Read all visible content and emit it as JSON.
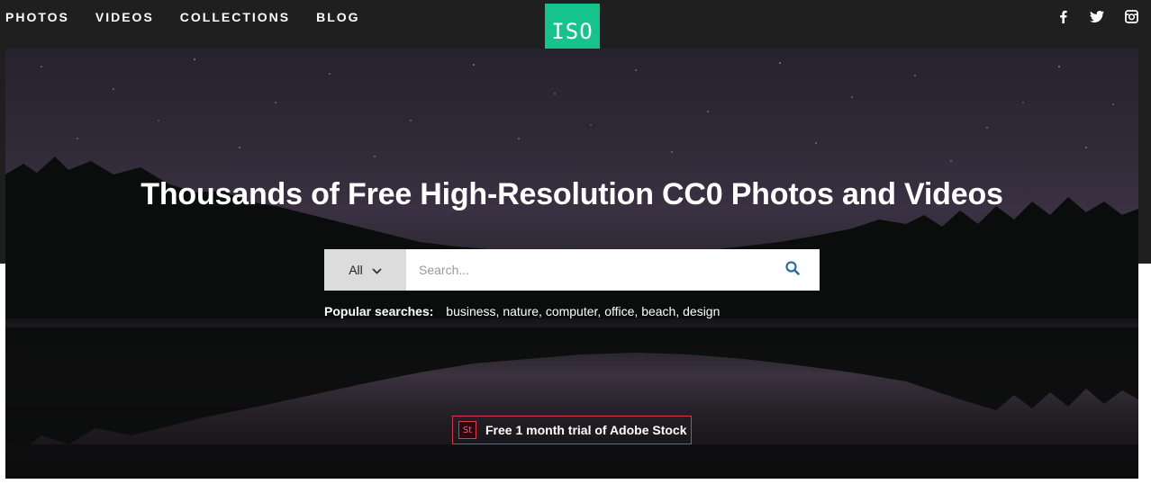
{
  "nav": {
    "items": [
      "PHOTOS",
      "VIDEOS",
      "COLLECTIONS",
      "BLOG"
    ]
  },
  "logo": {
    "text": "ISO"
  },
  "social": {
    "icons": [
      "facebook-icon",
      "twitter-icon",
      "instagram-icon"
    ]
  },
  "hero": {
    "headline": "Thousands of Free High-Resolution CC0 Photos and Videos"
  },
  "search": {
    "category": "All",
    "placeholder": "Search...",
    "value": ""
  },
  "popular": {
    "label": "Popular searches:",
    "terms": [
      "business",
      "nature",
      "computer",
      "office",
      "beach",
      "design"
    ]
  },
  "promo": {
    "badge": "St",
    "text": "Free 1 month trial of Adobe Stock"
  },
  "colors": {
    "topbar": "#1f1f1f",
    "logo_bg": "#16c38a",
    "promo_border": "#d23b4d",
    "search_icon": "#2b6f9b"
  }
}
